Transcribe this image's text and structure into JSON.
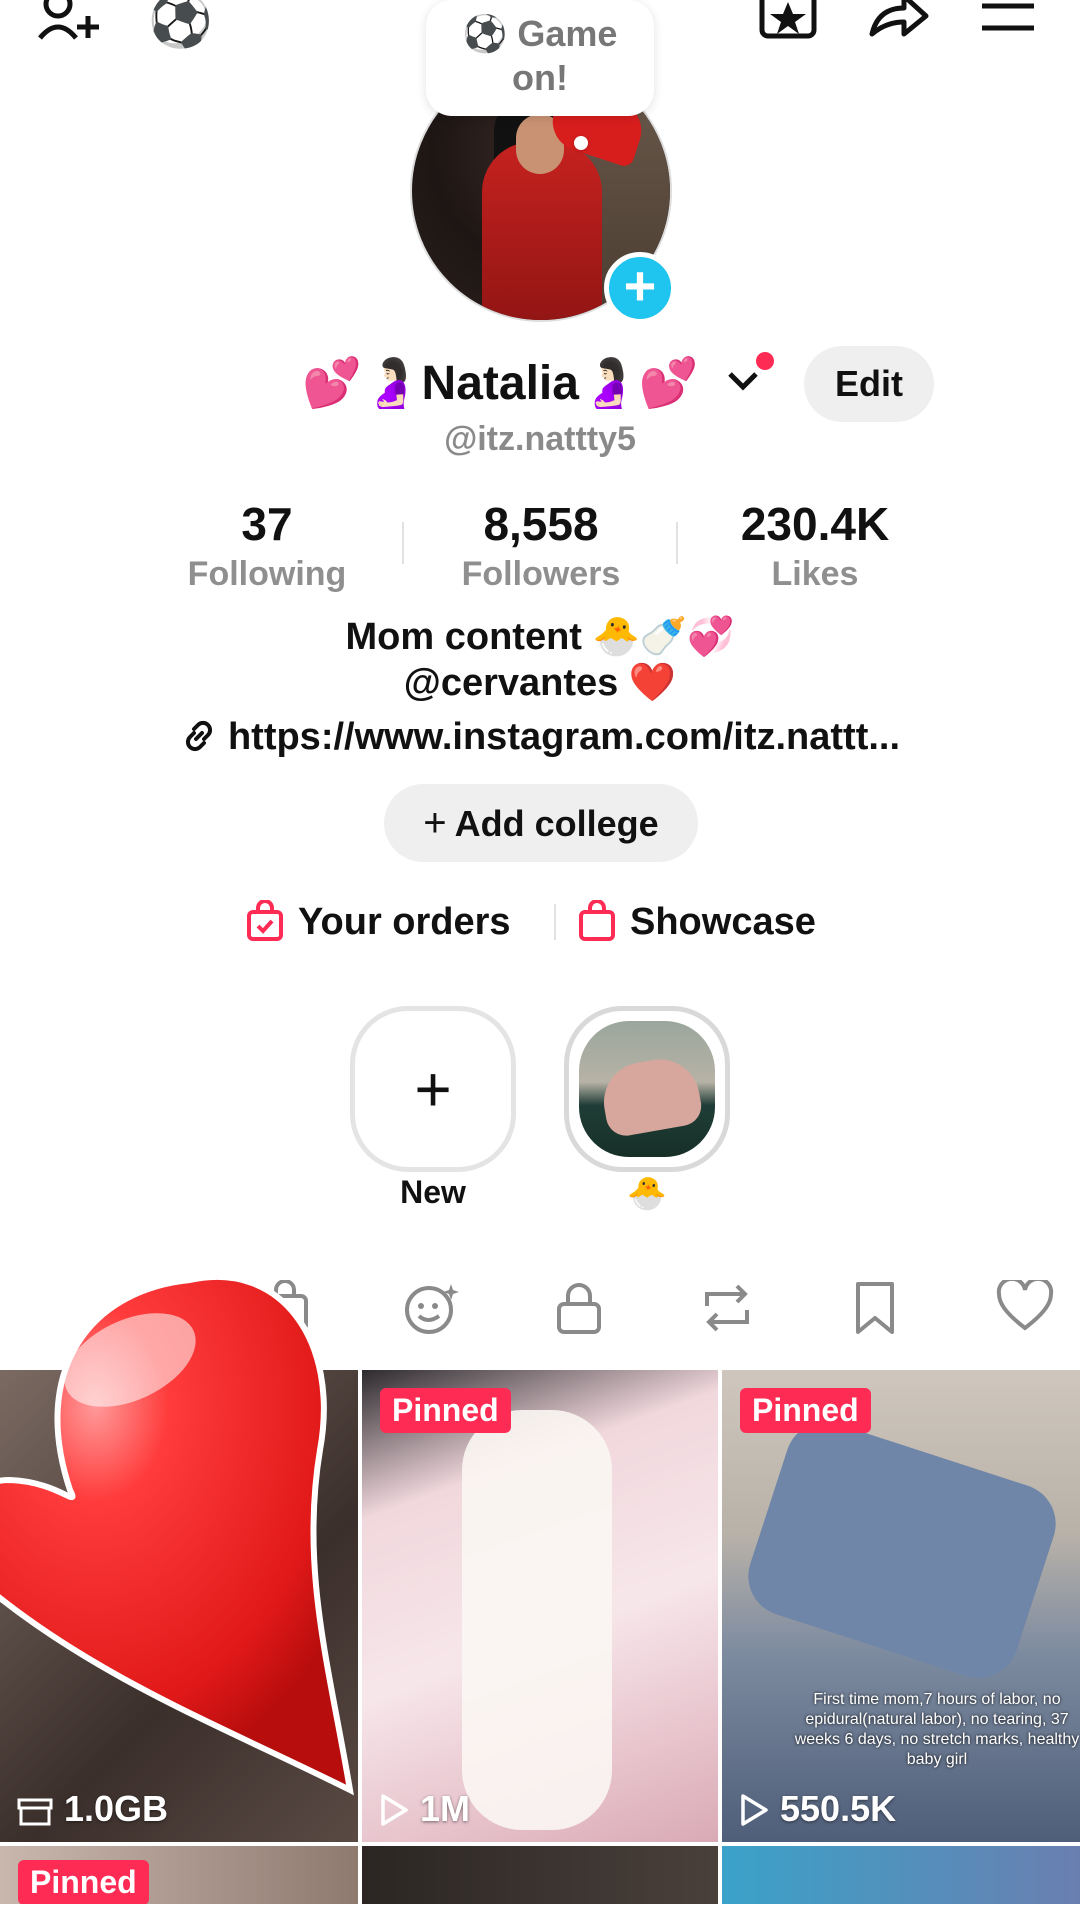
{
  "top_bubble": {
    "text": "⚽ Game on!"
  },
  "top_icons": [
    "add-friend-icon",
    "soccer-ball-icon",
    "star-badge-icon",
    "share-icon",
    "menu-icon"
  ],
  "profile": {
    "name": "💕🤰🏻Natalia🤰🏻💕",
    "handle": "@itz.nattty5",
    "edit_label": "Edit"
  },
  "stats": [
    {
      "value": "37",
      "label": "Following"
    },
    {
      "value": "8,558",
      "label": "Followers"
    },
    {
      "value": "230.4K",
      "label": "Likes"
    }
  ],
  "bio": {
    "line1": "Mom content 🐣🍼💞",
    "line2": "@cervantes ❤️",
    "link": "https://www.instagram.com/itz.nattt..."
  },
  "college_button": {
    "plus": "+",
    "label": "Add college"
  },
  "shop": {
    "orders": "Your orders",
    "showcase": "Showcase"
  },
  "stories": [
    {
      "label": "New"
    },
    {
      "label": "🐣"
    }
  ],
  "tabs": [
    "videos-grid-icon",
    "shop-bag-icon",
    "ai-face-icon",
    "lock-icon",
    "repost-icon",
    "bookmark-icon",
    "heart-icon"
  ],
  "grid": {
    "cells": [
      {
        "pinned": "",
        "views": "1.0GB",
        "views_icon": "storage-icon"
      },
      {
        "pinned": "Pinned",
        "views": "1M",
        "views_icon": "play-icon"
      },
      {
        "pinned": "Pinned",
        "views": "550.5K",
        "views_icon": "play-icon",
        "overlay": "First time mom,7 hours of labor, no epidural(natural labor), no tearing, 37 weeks 6 days, no stretch marks, healthy baby girl"
      },
      {
        "pinned": "Pinned"
      }
    ]
  },
  "colors": {
    "accent": "#fe2c55",
    "blue_badge": "#1fc5ee",
    "text_secondary": "#8f8f8f"
  }
}
